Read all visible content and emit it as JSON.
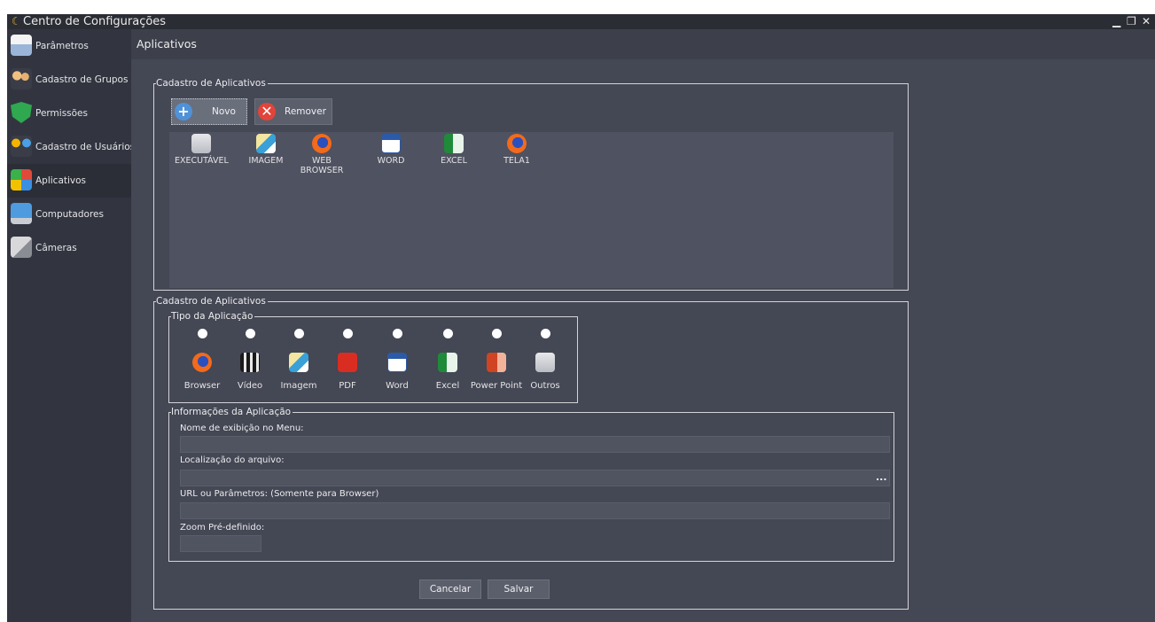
{
  "window": {
    "title": "Centro de Configurações",
    "icon": "app-moon-icon"
  },
  "sidebar": {
    "items": [
      {
        "label": "Parâmetros",
        "icon": "parameters-icon"
      },
      {
        "label": "Cadastro de Grupos",
        "icon": "groups-icon"
      },
      {
        "label": "Permissões",
        "icon": "shield-check-icon"
      },
      {
        "label": "Cadastro de Usuários",
        "icon": "users-icon"
      },
      {
        "label": "Aplicativos",
        "icon": "apps-icon",
        "active": true
      },
      {
        "label": "Computadores",
        "icon": "computer-icon"
      },
      {
        "label": "Câmeras",
        "icon": "camera-icon"
      }
    ]
  },
  "main": {
    "title": "Aplicativos",
    "list_group": {
      "legend": "Cadastro de Aplicativos",
      "new_label": "Novo",
      "remove_label": "Remover",
      "apps": [
        {
          "label": "EXECUTÁVEL",
          "icon": "executable-icon"
        },
        {
          "label": "IMAGEM",
          "icon": "image-icon"
        },
        {
          "label": "WEB BROWSER",
          "icon": "firefox-icon"
        },
        {
          "label": "WORD",
          "icon": "word-icon"
        },
        {
          "label": "EXCEL",
          "icon": "excel-icon"
        },
        {
          "label": "TELA1",
          "icon": "firefox-icon"
        }
      ]
    },
    "form_group": {
      "legend": "Cadastro de Aplicativos",
      "type_legend": "Tipo da Aplicação",
      "types": [
        {
          "label": "Browser",
          "icon": "firefox-icon"
        },
        {
          "label": "Vídeo",
          "icon": "video-icon"
        },
        {
          "label": "Imagem",
          "icon": "image-icon"
        },
        {
          "label": "PDF",
          "icon": "pdf-icon"
        },
        {
          "label": "Word",
          "icon": "word-icon"
        },
        {
          "label": "Excel",
          "icon": "excel-icon"
        },
        {
          "label": "Power Point",
          "icon": "powerpoint-icon"
        },
        {
          "label": "Outros",
          "icon": "executable-icon"
        }
      ],
      "info_legend": "Informações da Aplicação",
      "menu_name_label": "Nome de exibição no Menu:",
      "menu_name_value": "",
      "file_location_label": "Localização do arquivo:",
      "file_location_value": "",
      "browse_label": "...",
      "url_label": "URL ou Parâmetros: (Somente para Browser)",
      "url_value": "",
      "zoom_label": "Zoom Pré-definido:",
      "zoom_value": "",
      "cancel_label": "Cancelar",
      "save_label": "Salvar"
    }
  },
  "colors": {
    "background": "#444754",
    "sidebar": "#323540",
    "titlebar": "#2b2d35",
    "border": "#d4d4d8"
  }
}
